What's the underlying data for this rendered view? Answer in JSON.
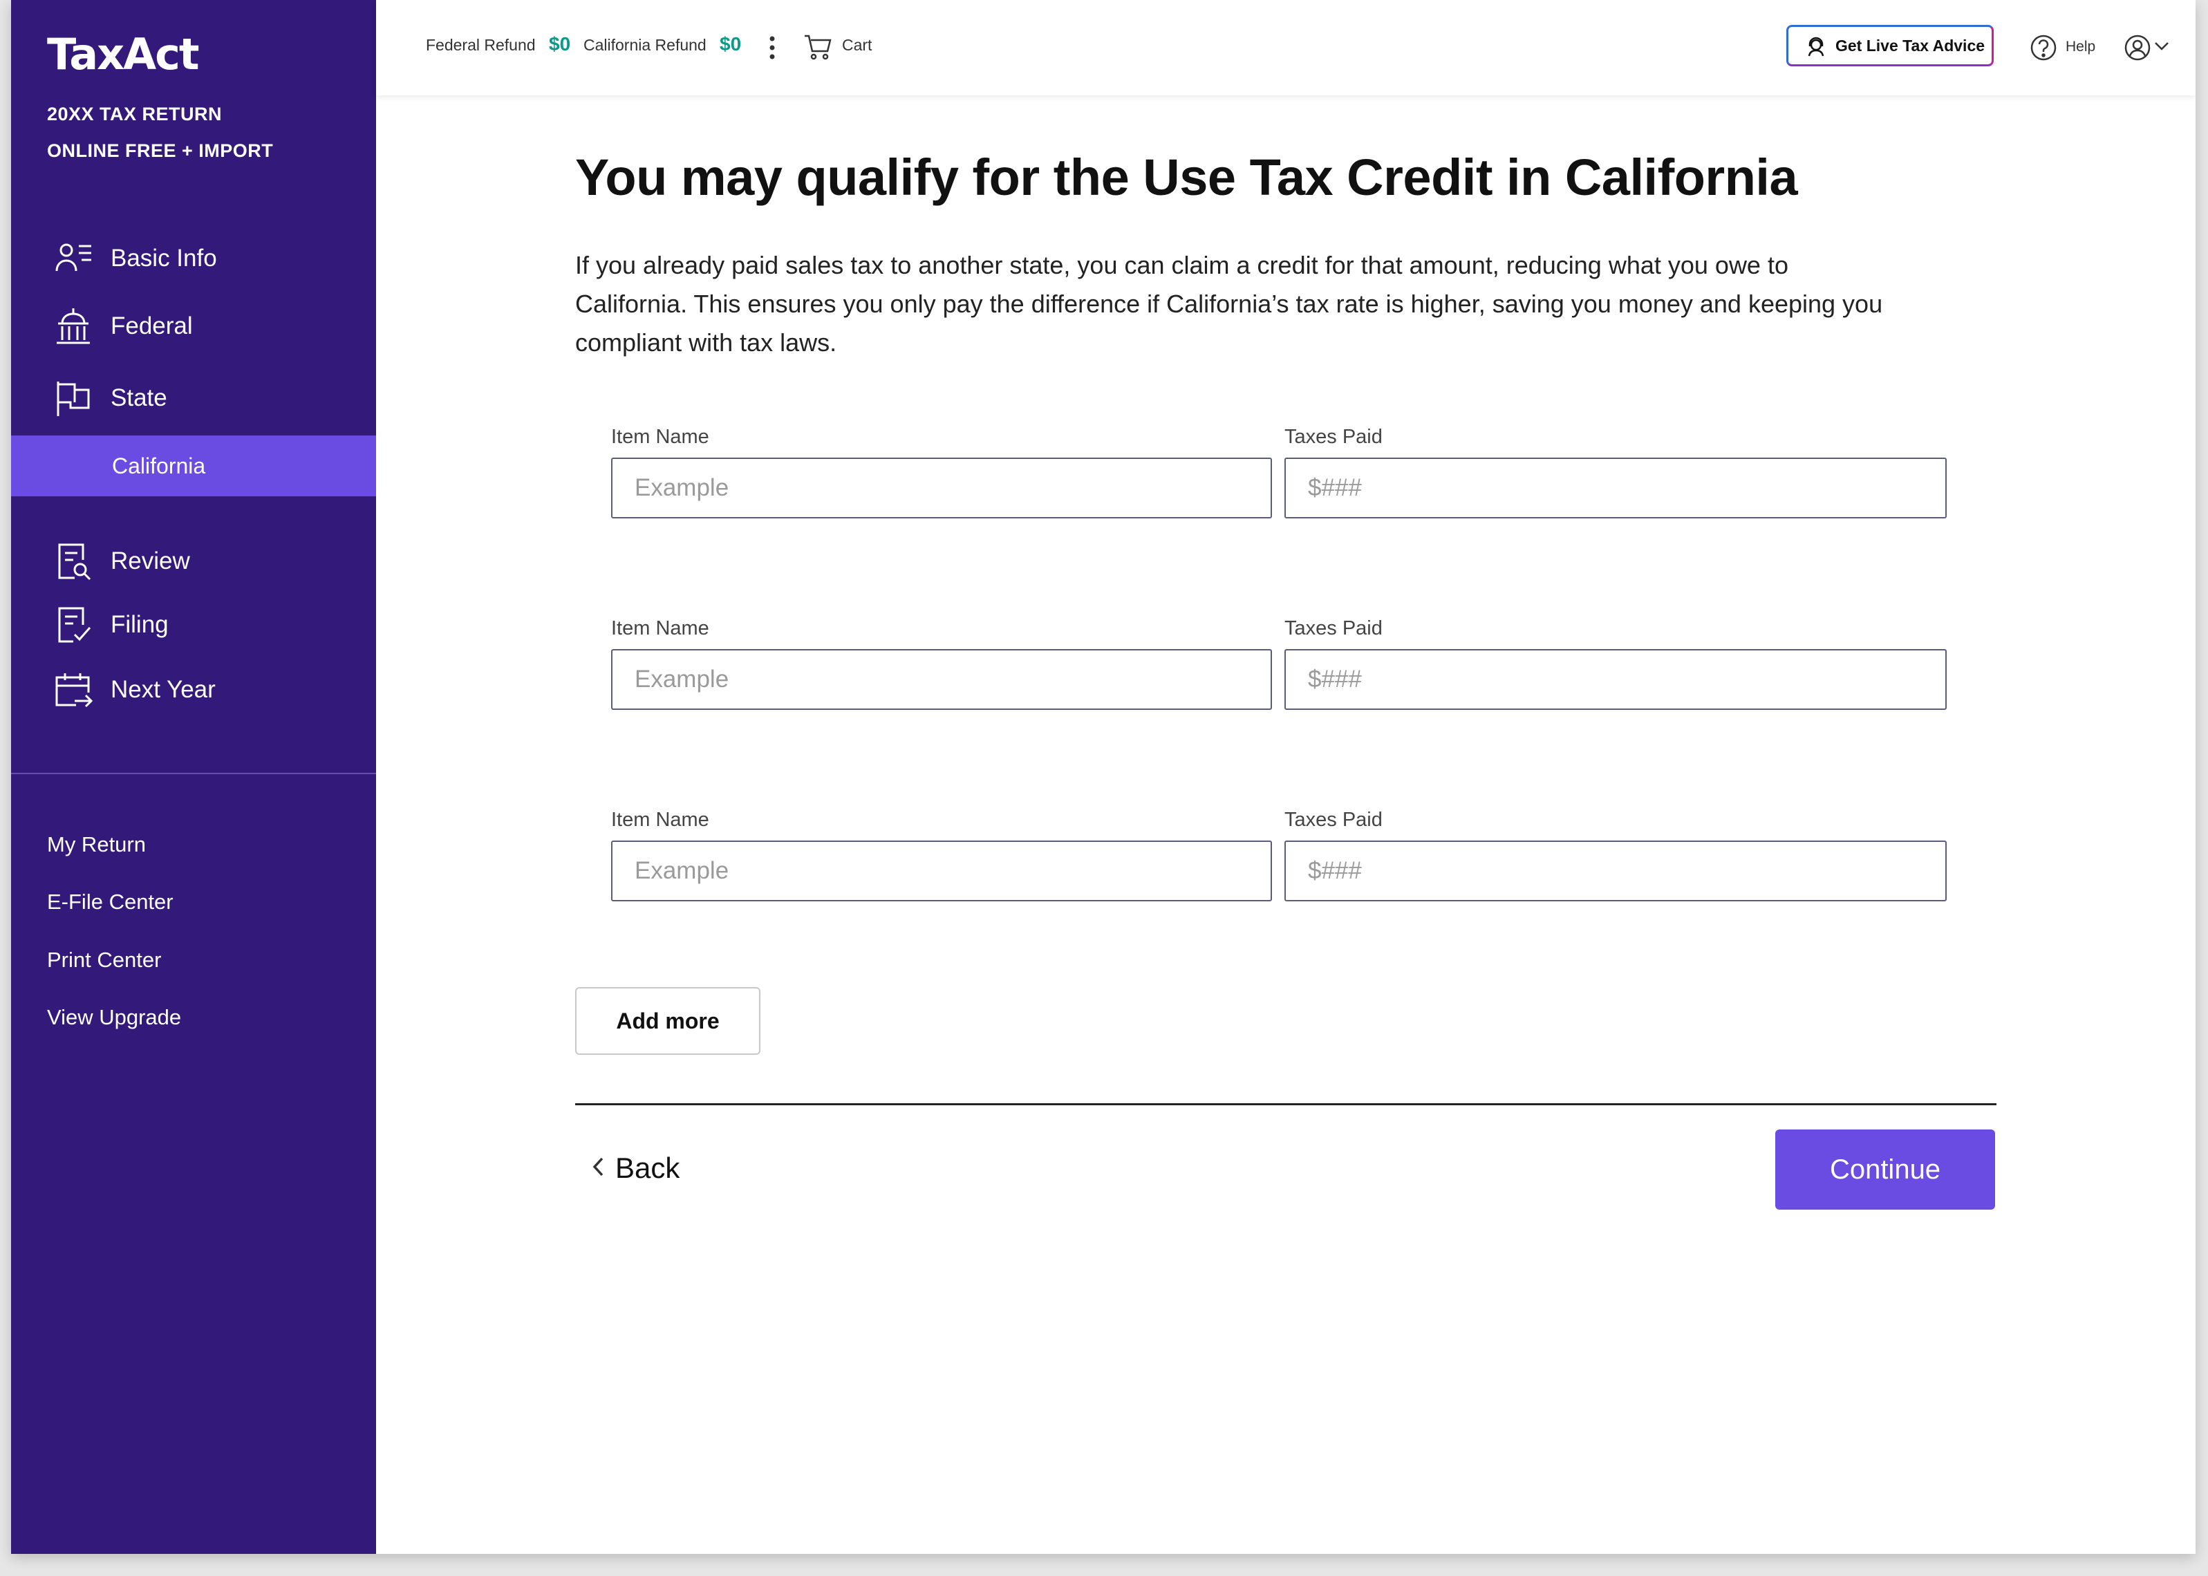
{
  "brand": {
    "logo": "TaxAct",
    "line1": "20XX TAX RETURN",
    "line2": "ONLINE FREE + IMPORT"
  },
  "sidebar": {
    "nav": [
      {
        "label": "Basic Info",
        "icon": "person-list-icon"
      },
      {
        "label": "Federal",
        "icon": "capitol-building-icon"
      },
      {
        "label": "State",
        "icon": "flag-icon"
      },
      {
        "label": "Review",
        "icon": "document-search-icon"
      },
      {
        "label": "Filing",
        "icon": "document-check-icon"
      },
      {
        "label": "Next Year",
        "icon": "calendar-arrow-icon"
      }
    ],
    "active_sub": "California",
    "links": [
      "My Return",
      "E-File Center",
      "Print Center",
      "View Upgrade"
    ],
    "colors": {
      "background": "#32197a",
      "active": "#6a4ce3"
    }
  },
  "topbar": {
    "federal_label": "Federal Refund",
    "federal_amount": "$0",
    "state_label": "California Refund",
    "state_amount": "$0",
    "more_icon": "more-vertical-icon",
    "cart_label": "Cart",
    "live_advice_label": "Get Live Tax Advice",
    "help_label": "Help",
    "amount_color": "#0a9a8a"
  },
  "main": {
    "title": "You may qualify for the Use Tax Credit in California",
    "description": "If you already paid sales tax to another state, you can claim a credit for that amount, reducing what you owe to California. This ensures you only pay the difference if California’s tax rate is higher, saving you money and keeping you compliant with tax laws.",
    "rows": [
      {
        "item_label": "Item Name",
        "item_placeholder": "Example",
        "tax_label": "Taxes Paid",
        "tax_placeholder": "$###"
      },
      {
        "item_label": "Item Name",
        "item_placeholder": "Example",
        "tax_label": "Taxes Paid",
        "tax_placeholder": "$###"
      },
      {
        "item_label": "Item Name",
        "item_placeholder": "Example",
        "tax_label": "Taxes Paid",
        "tax_placeholder": "$###"
      }
    ],
    "add_more_label": "Add more",
    "back_label": "Back",
    "continue_label": "Continue",
    "accent": "#6a4ce3"
  }
}
